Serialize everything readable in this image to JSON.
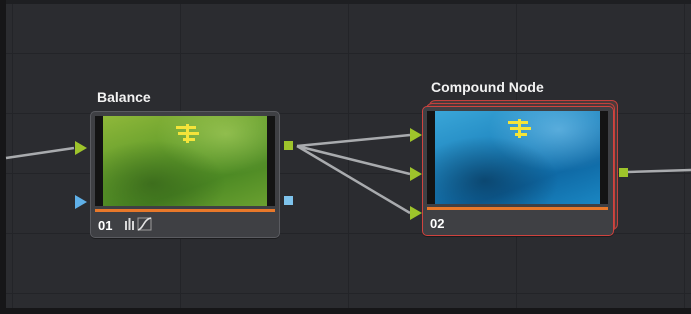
{
  "nodes": [
    {
      "name": "Balance",
      "id": "01",
      "thumbnail": "green-water-aerial",
      "tool_icons": [
        "bars-icon",
        "curves-icon"
      ]
    },
    {
      "name": "Compound Node",
      "id": "02",
      "thumbnail": "blue-water-aerial",
      "selected": true
    }
  ],
  "colors": {
    "rgb_input_port": "#9ec42b",
    "key_input_port": "#5fb0e8",
    "rgb_output_port": "#9ec42b",
    "key_output_port": "#7ec3ec",
    "wire": "#a9abae",
    "selection_outline": "#d0433f",
    "orange_bar": "#e8782a"
  }
}
